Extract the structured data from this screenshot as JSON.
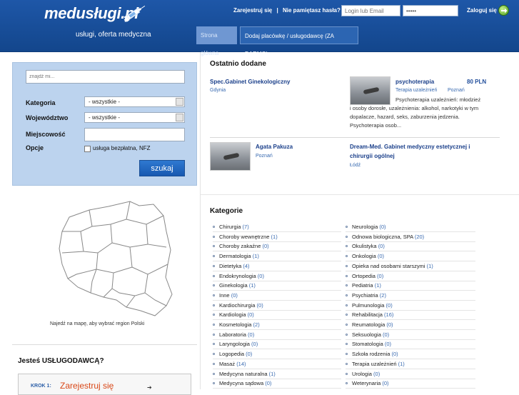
{
  "header": {
    "logo": "medusługi.pl",
    "tagline": "usługi, oferta medyczna",
    "register_link": "Zarejestruj się",
    "separator": "|",
    "forgot_link": "Nie pamiętasz hasła?",
    "login_placeholder": "Login lub Email",
    "password_value": "•••••",
    "login_button": "Zaloguj się",
    "nav": {
      "home": "Strona główna",
      "add": "Dodaj placówkę / usługodawcę (ZA DARMO)"
    }
  },
  "search": {
    "placeholder": "znajdź mi...",
    "category_label": "Kategoria",
    "category_value": "- wszystkie -",
    "province_label": "Województwo",
    "province_value": "- wszystkie -",
    "city_label": "Miejscowość",
    "options_label": "Opcje",
    "free_service_label": "usługa bezpłatna, NFZ",
    "submit": "szukaj"
  },
  "map": {
    "caption": "Najedź na mapę, aby wybrać region Polski"
  },
  "provider": {
    "title": "Jesteś USŁUGODAWCĄ?",
    "step_label": "KROK 1:",
    "step_link": "Zarejestruj się"
  },
  "recent": {
    "title": "Ostatnio dodane",
    "items": [
      {
        "title": "Spec.Gabinet Ginekologiczny",
        "location": "Gdynia"
      },
      {
        "title": "psychoterapia",
        "price": "80 PLN",
        "category": "Terapia uzależnień",
        "location": "Poznań",
        "description_lines": [
          "Psychoterapia uzależnień: młodzież",
          "i osoby dorosłe, uzależnienia: alkohol, narkotyki w tym",
          "dopalacze, hazard, seks, zaburzenia jedzenia.",
          "Psychoterapia osob..."
        ]
      },
      {
        "title": "Agata Pakuza",
        "location": "Poznań"
      },
      {
        "title_lines": [
          "Dream-Med. Gabinet medyczny estetycznej i",
          "chirurgii ogólnej"
        ],
        "location": "Łódź"
      }
    ]
  },
  "categories": {
    "title": "Kategorie",
    "left": [
      {
        "name": "Chirurgia",
        "count": "(7)"
      },
      {
        "name": "Choroby wewnętrzne",
        "count": "(1)"
      },
      {
        "name": "Choroby zakaźne",
        "count": "(0)"
      },
      {
        "name": "Dermatologia",
        "count": "(1)"
      },
      {
        "name": "Dietetyka",
        "count": "(4)"
      },
      {
        "name": "Endokrynologia",
        "count": "(0)"
      },
      {
        "name": "Ginekologia",
        "count": "(1)"
      },
      {
        "name": "Inne",
        "count": "(0)"
      },
      {
        "name": "Kardiochirurgia",
        "count": "(0)"
      },
      {
        "name": "Kardiologia",
        "count": "(0)"
      },
      {
        "name": "Kosmetologia",
        "count": "(2)"
      },
      {
        "name": "Laboratoria",
        "count": "(0)"
      },
      {
        "name": "Laryngologia",
        "count": "(0)"
      },
      {
        "name": "Logopedia",
        "count": "(0)"
      },
      {
        "name": "Masaż",
        "count": "(14)"
      },
      {
        "name": "Medycyna naturalna",
        "count": "(1)"
      },
      {
        "name": "Medycyna sądowa",
        "count": "(0)"
      }
    ],
    "right": [
      {
        "name": "Neurologia",
        "count": "(0)"
      },
      {
        "name": "Odnowa biologiczna, SPA",
        "count": "(20)"
      },
      {
        "name": "Okulistyka",
        "count": "(0)"
      },
      {
        "name": "Onkologia",
        "count": "(0)"
      },
      {
        "name": "Opieka nad osobami starszymi",
        "count": "(1)"
      },
      {
        "name": "Ortopedia",
        "count": "(0)"
      },
      {
        "name": "Pediatria",
        "count": "(1)"
      },
      {
        "name": "Psychiatria",
        "count": "(2)"
      },
      {
        "name": "Pulmunologia",
        "count": "(0)"
      },
      {
        "name": "Rehabilitacja",
        "count": "(16)"
      },
      {
        "name": "Reumatologia",
        "count": "(0)"
      },
      {
        "name": "Seksuologia",
        "count": "(0)"
      },
      {
        "name": "Stomatologia",
        "count": "(0)"
      },
      {
        "name": "Szkoła rodzenia",
        "count": "(0)"
      },
      {
        "name": "Terapia uzależnień",
        "count": "(1)"
      },
      {
        "name": "Urologia",
        "count": "(0)"
      },
      {
        "name": "Weterynaria",
        "count": "(0)"
      }
    ]
  }
}
